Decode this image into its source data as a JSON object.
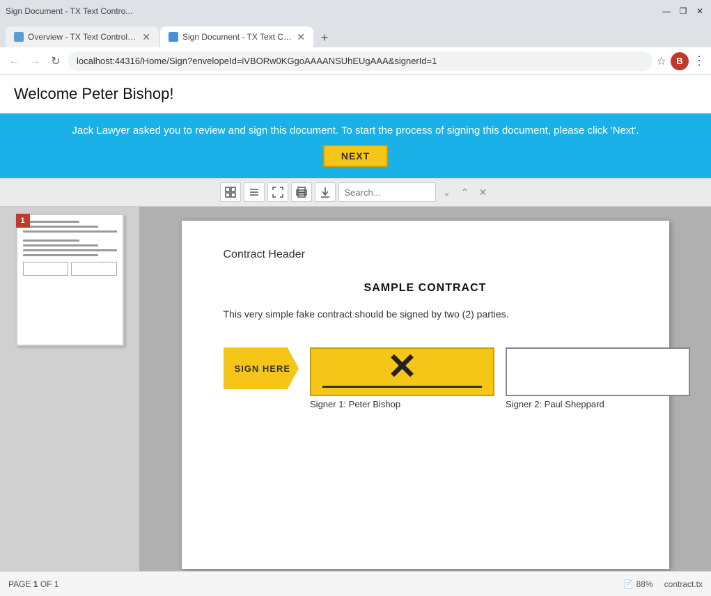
{
  "browser": {
    "tabs": [
      {
        "id": "tab1",
        "title": "Overview - TX Text Control Samp",
        "active": false,
        "favicon": "O"
      },
      {
        "id": "tab2",
        "title": "Sign Document - TX Text Contro...",
        "active": true,
        "favicon": "S"
      }
    ],
    "new_tab_label": "+",
    "address": "localhost:44316/Home/Sign?envelopeId=iVBORw0KGgoAAAANSUhEUgAAA&signerId=1",
    "profile_initial": "B",
    "controls": {
      "minimize": "—",
      "restore": "❐",
      "close": "✕"
    }
  },
  "app": {
    "title": "Welcome Peter Bishop!",
    "banner": {
      "text": "Jack Lawyer asked you to review and sign this document. To start the process of signing this document, please click 'Next'.",
      "next_button": "NEXT"
    }
  },
  "toolbar": {
    "search_placeholder": "Search...",
    "buttons": {
      "layout": "▦",
      "list": "≡",
      "fullscreen": "⛶",
      "print": "⎙",
      "download": "↓"
    }
  },
  "sidebar": {
    "page_number": "1"
  },
  "document": {
    "contract_header": "Contract Header",
    "title": "SAMPLE CONTRACT",
    "body": "This very simple fake contract should be signed by two (2) parties.",
    "sign_here_label": "SIGN HERE",
    "signer1_label": "Signer 1: Peter Bishop",
    "signer2_label": "Signer 2: Paul Sheppard"
  },
  "status_bar": {
    "page_label": "PAGE",
    "page_current": "1",
    "page_of": "OF",
    "page_total": "1",
    "zoom": "88%",
    "filename": "contract.tx"
  }
}
